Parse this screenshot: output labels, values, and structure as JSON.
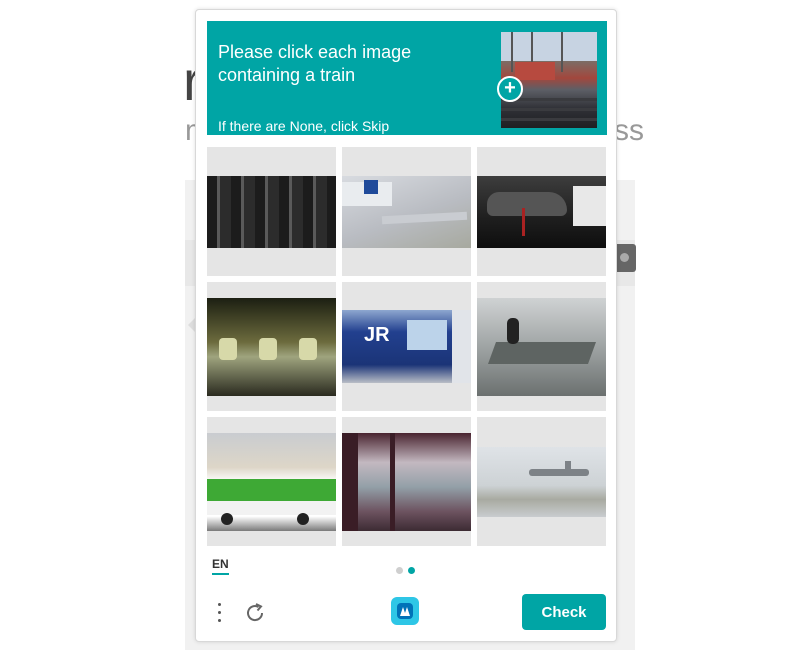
{
  "background": {
    "letter": "r",
    "sub_left": "m",
    "sub_right": "ss"
  },
  "prompt": {
    "title": "Please click each image containing a train",
    "subtitle": "If there are None, click Skip",
    "sample_icon": "plus-icon",
    "color": "#00a5a5"
  },
  "grid": {
    "tiles": [
      {
        "name": "subway-platform"
      },
      {
        "name": "airplane-wing"
      },
      {
        "name": "sports-car"
      },
      {
        "name": "subway-car-interior"
      },
      {
        "name": "jr-train"
      },
      {
        "name": "boat"
      },
      {
        "name": "green-bus"
      },
      {
        "name": "train-window-view"
      },
      {
        "name": "airplane-runway"
      }
    ]
  },
  "footer": {
    "language": "EN",
    "pagination": {
      "count": 2,
      "active": 2
    },
    "more_icon": "kebab-menu-icon",
    "refresh_icon": "refresh-icon",
    "logo_icon": "hcaptcha-logo-icon",
    "check_label": "Check"
  }
}
